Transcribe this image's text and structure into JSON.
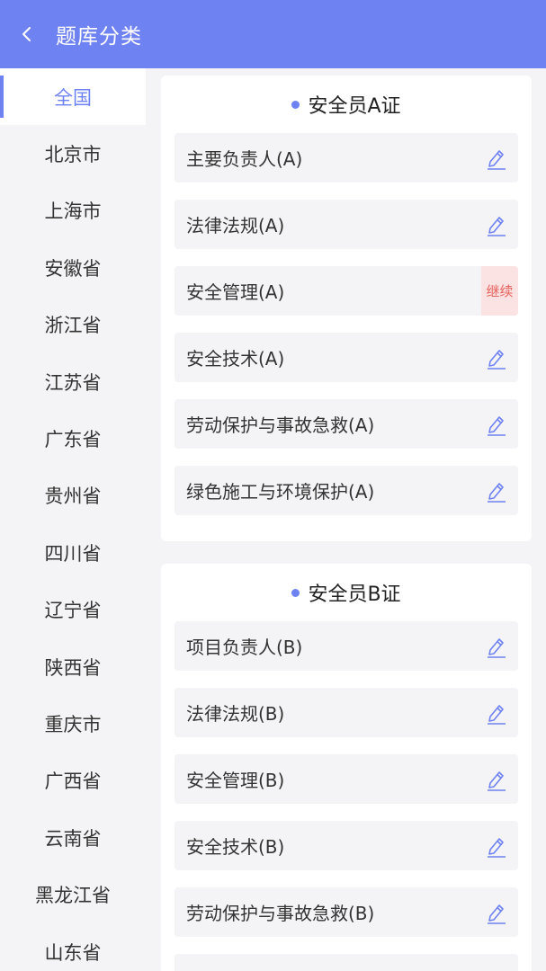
{
  "header": {
    "title": "题库分类"
  },
  "sidebar": {
    "items": [
      "全国",
      "北京市",
      "上海市",
      "安徽省",
      "浙江省",
      "江苏省",
      "广东省",
      "贵州省",
      "四川省",
      "辽宁省",
      "陕西省",
      "重庆市",
      "广西省",
      "云南省",
      "黑龙江省",
      "山东省"
    ],
    "active_index": 0
  },
  "sections": [
    {
      "title": "安全员A证",
      "items": [
        {
          "label": "主要负责人(A)",
          "action": "edit-icon"
        },
        {
          "label": "法律法规(A)",
          "action": "edit-icon"
        },
        {
          "label": "安全管理(A)",
          "action": "继续"
        },
        {
          "label": "安全技术(A)",
          "action": "edit-icon"
        },
        {
          "label": "劳动保护与事故急救(A)",
          "action": "edit-icon"
        },
        {
          "label": "绿色施工与环境保护(A)",
          "action": "edit-icon"
        }
      ]
    },
    {
      "title": "安全员B证",
      "items": [
        {
          "label": "项目负责人(B)",
          "action": "edit-icon"
        },
        {
          "label": "法律法规(B)",
          "action": "edit-icon"
        },
        {
          "label": "安全管理(B)",
          "action": "edit-icon"
        },
        {
          "label": "安全技术(B)",
          "action": "edit-icon"
        },
        {
          "label": "劳动保护与事故急救(B)",
          "action": "edit-icon"
        }
      ]
    }
  ],
  "colors": {
    "accent": "#6f82f1",
    "continue_bg": "#fbe3e3",
    "continue_text": "#e6625e"
  }
}
